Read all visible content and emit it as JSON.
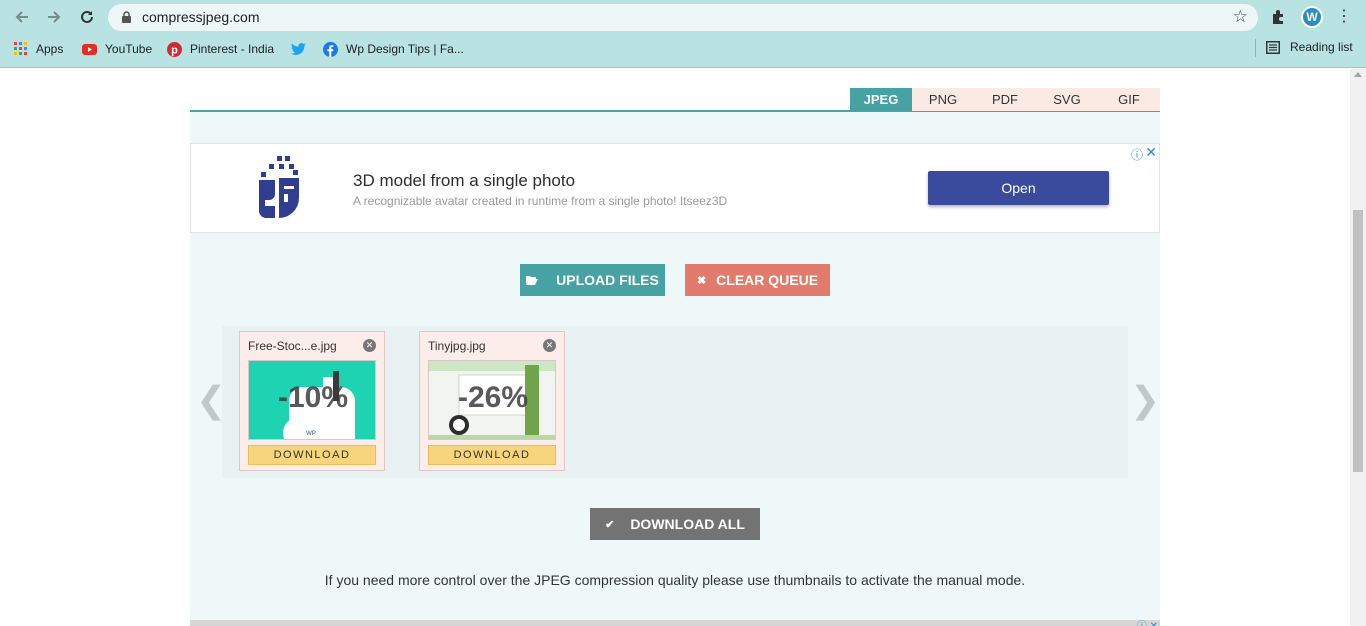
{
  "browser": {
    "url": "compressjpeg.com",
    "profile_initial": "W",
    "bookmarks": [
      {
        "label": "Apps",
        "icon": "apps-grid-icon"
      },
      {
        "label": "YouTube",
        "icon": "youtube-icon"
      },
      {
        "label": "Pinterest - India",
        "icon": "pinterest-icon"
      },
      {
        "label": "",
        "icon": "twitter-icon"
      },
      {
        "label": "Wp Design Tips | Fa...",
        "icon": "facebook-icon"
      }
    ],
    "reading_list": "Reading list"
  },
  "tabs": [
    {
      "label": "JPEG",
      "active": true
    },
    {
      "label": "PNG",
      "active": false
    },
    {
      "label": "PDF",
      "active": false
    },
    {
      "label": "SVG",
      "active": false
    },
    {
      "label": "GIF",
      "active": false
    }
  ],
  "ad": {
    "title": "3D model from a single photo",
    "subtitle": "A recognizable avatar created in runtime from a single photo! Itseez3D",
    "cta": "Open"
  },
  "actions": {
    "upload": "UPLOAD FILES",
    "clear": "CLEAR QUEUE",
    "download_all": "DOWNLOAD ALL"
  },
  "files": [
    {
      "name": "Free-Stoc...e.jpg",
      "reduction": "-10%",
      "download": "DOWNLOAD"
    },
    {
      "name": "Tinyjpg.jpg",
      "reduction": "-26%",
      "download": "DOWNLOAD"
    }
  ],
  "info": "If you need more control over the JPEG compression quality please use thumbnails to activate the manual mode.",
  "colors": {
    "accent": "#47a3a3",
    "clear": "#e27b6b",
    "download": "#f7d57c",
    "ad_button": "#3a4a9c"
  }
}
